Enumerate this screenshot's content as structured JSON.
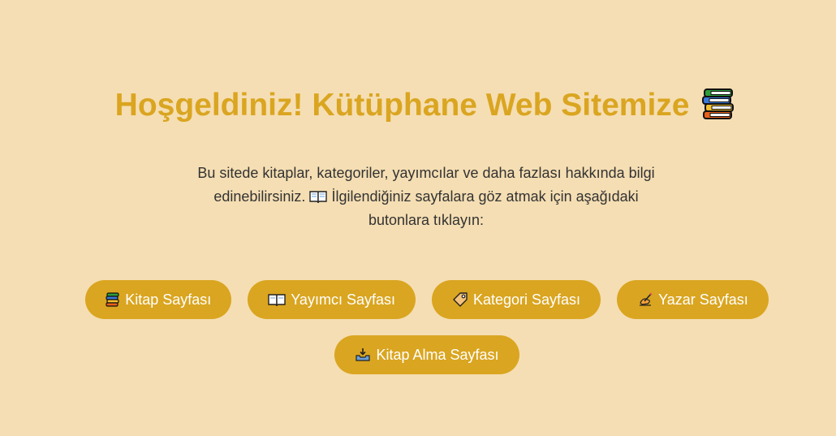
{
  "header": {
    "title": "Hoşgeldiniz! Kütüphane Web Sitemize",
    "title_icon": "books-stack-icon"
  },
  "intro": {
    "text_before_icon": "Bu sitede kitaplar, kategoriler, yayımcılar ve daha fazlası hakkında bilgi edinebilirsiniz.",
    "inline_icon": "open-book-icon",
    "text_after_icon": "İlgilendiğiniz sayfalara göz atmak için aşağıdaki butonlara tıklayın:"
  },
  "nav": {
    "buttons": [
      {
        "label": "Kitap Sayfası",
        "icon": "books-icon"
      },
      {
        "label": "Yayımcı Sayfası",
        "icon": "open-book-icon"
      },
      {
        "label": "Kategori Sayfası",
        "icon": "tag-icon"
      },
      {
        "label": "Yazar Sayfası",
        "icon": "writing-hand-icon"
      },
      {
        "label": "Kitap Alma Sayfası",
        "icon": "inbox-tray-icon"
      }
    ]
  },
  "colors": {
    "background": "#f5deb3",
    "accent": "#daa520",
    "text": "#333333",
    "button_text": "#ffffff"
  }
}
